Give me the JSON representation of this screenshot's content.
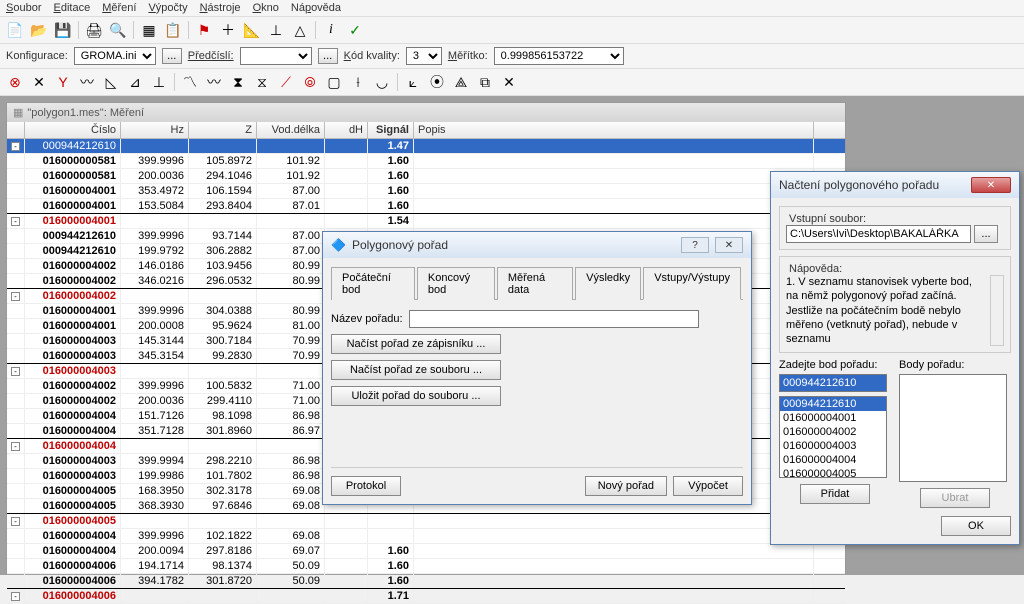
{
  "menu": {
    "items": [
      "Soubor",
      "Editace",
      "Měření",
      "Výpočty",
      "Nástroje",
      "Okno",
      "Nápověda"
    ]
  },
  "config": {
    "label": "Konfigurace:",
    "value": "GROMA.ini",
    "predcisli_label": "Předčíslí:",
    "predcisli_value": "",
    "kod_label": "Kód kvality:",
    "kod_value": "3",
    "meritko_label": "Měřítko:",
    "meritko_value": "0.999856153722"
  },
  "mdi": {
    "title": "\"polygon1.mes\": Měření",
    "columns": [
      "",
      "Číslo",
      "Hz",
      "Z",
      "Vod.délka",
      "dH",
      "Signál",
      "Popis"
    ],
    "rows": [
      {
        "tree": "-",
        "c": [
          "000944212610",
          "",
          "",
          "",
          "",
          "1.47",
          ""
        ],
        "sel": true
      },
      {
        "c": [
          "016000000581",
          "399.9996",
          "105.8972",
          "101.92",
          "",
          "1.60",
          ""
        ],
        "bold": true
      },
      {
        "c": [
          "016000000581",
          "200.0036",
          "294.1046",
          "101.92",
          "",
          "1.60",
          ""
        ],
        "bold": true
      },
      {
        "c": [
          "016000004001",
          "353.4972",
          "106.1594",
          "87.00",
          "",
          "1.60",
          ""
        ],
        "bold": true
      },
      {
        "c": [
          "016000004001",
          "153.5084",
          "293.8404",
          "87.01",
          "",
          "1.60",
          ""
        ],
        "bold": true,
        "sep": true
      },
      {
        "tree": "-",
        "c": [
          "016000004001",
          "",
          "",
          "",
          "",
          "1.54",
          ""
        ],
        "red": true
      },
      {
        "c": [
          "000944212610",
          "399.9996",
          "93.7144",
          "87.00",
          "",
          "",
          ""
        ],
        "bold": true
      },
      {
        "c": [
          "000944212610",
          "199.9792",
          "306.2882",
          "87.00",
          "",
          "",
          ""
        ],
        "bold": true
      },
      {
        "c": [
          "016000004002",
          "146.0186",
          "103.9456",
          "80.99",
          "",
          "",
          ""
        ],
        "bold": true
      },
      {
        "c": [
          "016000004002",
          "346.0216",
          "296.0532",
          "80.99",
          "",
          "",
          ""
        ],
        "bold": true,
        "sep": true
      },
      {
        "tree": "-",
        "c": [
          "016000004002",
          "",
          "",
          "",
          "",
          "",
          ""
        ],
        "red": true
      },
      {
        "c": [
          "016000004001",
          "399.9996",
          "304.0388",
          "80.99",
          "",
          "",
          ""
        ],
        "bold": true
      },
      {
        "c": [
          "016000004001",
          "200.0008",
          "95.9624",
          "81.00",
          "",
          "",
          ""
        ],
        "bold": true
      },
      {
        "c": [
          "016000004003",
          "145.3144",
          "300.7184",
          "70.99",
          "",
          "",
          ""
        ],
        "bold": true
      },
      {
        "c": [
          "016000004003",
          "345.3154",
          "99.2830",
          "70.99",
          "",
          "",
          ""
        ],
        "bold": true,
        "sep": true
      },
      {
        "tree": "-",
        "c": [
          "016000004003",
          "",
          "",
          "",
          "",
          "",
          ""
        ],
        "red": true
      },
      {
        "c": [
          "016000004002",
          "399.9996",
          "100.5832",
          "71.00",
          "",
          "",
          ""
        ],
        "bold": true
      },
      {
        "c": [
          "016000004002",
          "200.0036",
          "299.4110",
          "71.00",
          "",
          "",
          ""
        ],
        "bold": true
      },
      {
        "c": [
          "016000004004",
          "151.7126",
          "98.1098",
          "86.98",
          "",
          "",
          ""
        ],
        "bold": true
      },
      {
        "c": [
          "016000004004",
          "351.7128",
          "301.8960",
          "86.97",
          "",
          "",
          ""
        ],
        "bold": true,
        "sep": true
      },
      {
        "tree": "-",
        "c": [
          "016000004004",
          "",
          "",
          "",
          "",
          "",
          ""
        ],
        "red": true
      },
      {
        "c": [
          "016000004003",
          "399.9994",
          "298.2210",
          "86.98",
          "",
          "",
          ""
        ],
        "bold": true
      },
      {
        "c": [
          "016000004003",
          "199.9986",
          "101.7802",
          "86.98",
          "",
          "",
          ""
        ],
        "bold": true
      },
      {
        "c": [
          "016000004005",
          "168.3950",
          "302.3178",
          "69.08",
          "",
          "",
          ""
        ],
        "bold": true
      },
      {
        "c": [
          "016000004005",
          "368.3930",
          "97.6846",
          "69.08",
          "",
          "",
          ""
        ],
        "bold": true,
        "sep": true
      },
      {
        "tree": "-",
        "c": [
          "016000004005",
          "",
          "",
          "",
          "",
          "",
          ""
        ],
        "red": true
      },
      {
        "c": [
          "016000004004",
          "399.9996",
          "102.1822",
          "69.08",
          "",
          "",
          ""
        ],
        "bold": true
      },
      {
        "c": [
          "016000004004",
          "200.0094",
          "297.8186",
          "69.07",
          "",
          "1.60",
          ""
        ],
        "bold": true
      },
      {
        "c": [
          "016000004006",
          "194.1714",
          "98.1374",
          "50.09",
          "",
          "1.60",
          ""
        ],
        "bold": true
      },
      {
        "c": [
          "016000004006",
          "394.1782",
          "301.8720",
          "50.09",
          "",
          "1.60",
          ""
        ],
        "bold": true,
        "sep": true
      },
      {
        "tree": "-",
        "c": [
          "016000004006",
          "",
          "",
          "",
          "",
          "1.71",
          ""
        ],
        "red": true
      }
    ]
  },
  "dlg1": {
    "title": "Polygonový pořad",
    "tabs": [
      "Počáteční bod",
      "Koncový bod",
      "Měřená data",
      "Výsledky",
      "Vstupy/Výstupy"
    ],
    "active_tab": 4,
    "nazev_label": "Název pořadu:",
    "nazev_value": "",
    "btn1": "Načíst pořad ze zápisníku ...",
    "btn2": "Načíst pořad ze souboru ...",
    "btn3": "Uložit pořad do souboru ...",
    "protokol": "Protokol",
    "novy": "Nový pořad",
    "vypocet": "Výpočet"
  },
  "dlg2": {
    "title": "Načtení polygonového pořadu",
    "vstup_title": " Vstupní soubor: ",
    "vstup_path": "C:\\Users\\Ivi\\Desktop\\BAKALÁŘKA",
    "napoveda_title": " Nápověda: ",
    "napoveda_text": "1. V seznamu stanovisek vyberte bod, na němž polygonový pořad začíná. Jestliže na počátečním bodě nebylo měřeno (vetknutý pořad), nebude v seznamu",
    "zadejte_label": "Zadejte bod pořadu:",
    "body_label": "Body pořadu:",
    "zadejte_value": "000944212610",
    "list": [
      "000944212610",
      "016000004001",
      "016000004002",
      "016000004003",
      "016000004004",
      "016000004005"
    ],
    "pridat": "Přidat",
    "ubrat": "Ubrat",
    "ok": "OK"
  }
}
